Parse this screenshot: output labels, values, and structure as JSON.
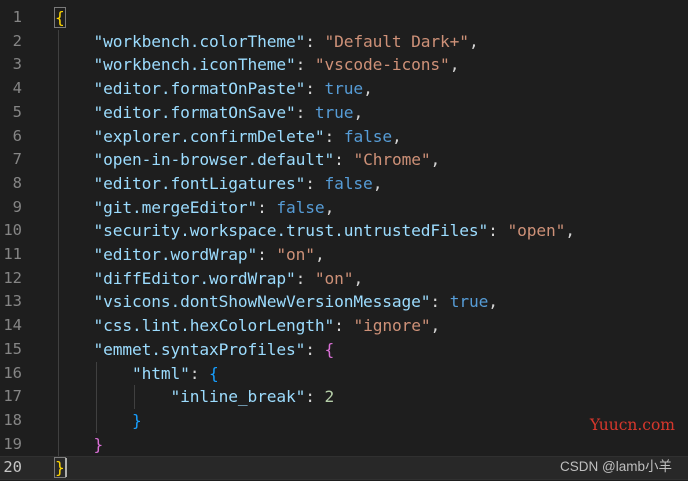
{
  "editor": {
    "lines": [
      {
        "number": "1",
        "tokens": [
          {
            "t": "{",
            "c": "tk-b1"
          }
        ]
      },
      {
        "number": "2",
        "tokens": [
          {
            "t": "    "
          },
          {
            "t": "\"workbench.colorTheme\"",
            "c": "tk-key"
          },
          {
            "t": ": ",
            "c": "tk-punc"
          },
          {
            "t": "\"Default Dark+\"",
            "c": "tk-str"
          },
          {
            "t": ",",
            "c": "tk-punc"
          }
        ]
      },
      {
        "number": "3",
        "tokens": [
          {
            "t": "    "
          },
          {
            "t": "\"workbench.iconTheme\"",
            "c": "tk-key"
          },
          {
            "t": ": ",
            "c": "tk-punc"
          },
          {
            "t": "\"vscode-icons\"",
            "c": "tk-str"
          },
          {
            "t": ",",
            "c": "tk-punc"
          }
        ]
      },
      {
        "number": "4",
        "tokens": [
          {
            "t": "    "
          },
          {
            "t": "\"editor.formatOnPaste\"",
            "c": "tk-key"
          },
          {
            "t": ": ",
            "c": "tk-punc"
          },
          {
            "t": "true",
            "c": "tk-bool"
          },
          {
            "t": ",",
            "c": "tk-punc"
          }
        ]
      },
      {
        "number": "5",
        "tokens": [
          {
            "t": "    "
          },
          {
            "t": "\"editor.formatOnSave\"",
            "c": "tk-key"
          },
          {
            "t": ": ",
            "c": "tk-punc"
          },
          {
            "t": "true",
            "c": "tk-bool"
          },
          {
            "t": ",",
            "c": "tk-punc"
          }
        ]
      },
      {
        "number": "6",
        "tokens": [
          {
            "t": "    "
          },
          {
            "t": "\"explorer.confirmDelete\"",
            "c": "tk-key"
          },
          {
            "t": ": ",
            "c": "tk-punc"
          },
          {
            "t": "false",
            "c": "tk-bool"
          },
          {
            "t": ",",
            "c": "tk-punc"
          }
        ]
      },
      {
        "number": "7",
        "tokens": [
          {
            "t": "    "
          },
          {
            "t": "\"open-in-browser.default\"",
            "c": "tk-key"
          },
          {
            "t": ": ",
            "c": "tk-punc"
          },
          {
            "t": "\"Chrome\"",
            "c": "tk-str"
          },
          {
            "t": ",",
            "c": "tk-punc"
          }
        ]
      },
      {
        "number": "8",
        "tokens": [
          {
            "t": "    "
          },
          {
            "t": "\"editor.fontLigatures\"",
            "c": "tk-key"
          },
          {
            "t": ": ",
            "c": "tk-punc"
          },
          {
            "t": "false",
            "c": "tk-bool"
          },
          {
            "t": ",",
            "c": "tk-punc"
          }
        ]
      },
      {
        "number": "9",
        "tokens": [
          {
            "t": "    "
          },
          {
            "t": "\"git.mergeEditor\"",
            "c": "tk-key"
          },
          {
            "t": ": ",
            "c": "tk-punc"
          },
          {
            "t": "false",
            "c": "tk-bool"
          },
          {
            "t": ",",
            "c": "tk-punc"
          }
        ]
      },
      {
        "number": "10",
        "tokens": [
          {
            "t": "    "
          },
          {
            "t": "\"security.workspace.trust.untrustedFiles\"",
            "c": "tk-key"
          },
          {
            "t": ": ",
            "c": "tk-punc"
          },
          {
            "t": "\"open\"",
            "c": "tk-str"
          },
          {
            "t": ",",
            "c": "tk-punc"
          }
        ]
      },
      {
        "number": "11",
        "tokens": [
          {
            "t": "    "
          },
          {
            "t": "\"editor.wordWrap\"",
            "c": "tk-key"
          },
          {
            "t": ": ",
            "c": "tk-punc"
          },
          {
            "t": "\"on\"",
            "c": "tk-str"
          },
          {
            "t": ",",
            "c": "tk-punc"
          }
        ]
      },
      {
        "number": "12",
        "tokens": [
          {
            "t": "    "
          },
          {
            "t": "\"diffEditor.wordWrap\"",
            "c": "tk-key"
          },
          {
            "t": ": ",
            "c": "tk-punc"
          },
          {
            "t": "\"on\"",
            "c": "tk-str"
          },
          {
            "t": ",",
            "c": "tk-punc"
          }
        ]
      },
      {
        "number": "13",
        "tokens": [
          {
            "t": "    "
          },
          {
            "t": "\"vsicons.dontShowNewVersionMessage\"",
            "c": "tk-key"
          },
          {
            "t": ": ",
            "c": "tk-punc"
          },
          {
            "t": "true",
            "c": "tk-bool"
          },
          {
            "t": ",",
            "c": "tk-punc"
          }
        ]
      },
      {
        "number": "14",
        "tokens": [
          {
            "t": "    "
          },
          {
            "t": "\"css.lint.hexColorLength\"",
            "c": "tk-key"
          },
          {
            "t": ": ",
            "c": "tk-punc"
          },
          {
            "t": "\"ignore\"",
            "c": "tk-str"
          },
          {
            "t": ",",
            "c": "tk-punc"
          }
        ]
      },
      {
        "number": "15",
        "tokens": [
          {
            "t": "    "
          },
          {
            "t": "\"emmet.syntaxProfiles\"",
            "c": "tk-key"
          },
          {
            "t": ": ",
            "c": "tk-punc"
          },
          {
            "t": "{",
            "c": "tk-b2"
          }
        ]
      },
      {
        "number": "16",
        "tokens": [
          {
            "t": "        "
          },
          {
            "t": "\"html\"",
            "c": "tk-key"
          },
          {
            "t": ": ",
            "c": "tk-punc"
          },
          {
            "t": "{",
            "c": "tk-b3"
          }
        ]
      },
      {
        "number": "17",
        "tokens": [
          {
            "t": "            "
          },
          {
            "t": "\"inline_break\"",
            "c": "tk-key"
          },
          {
            "t": ": ",
            "c": "tk-punc"
          },
          {
            "t": "2",
            "c": "tk-num"
          }
        ]
      },
      {
        "number": "18",
        "tokens": [
          {
            "t": "        "
          },
          {
            "t": "}",
            "c": "tk-b3"
          }
        ]
      },
      {
        "number": "19",
        "tokens": [
          {
            "t": "    "
          },
          {
            "t": "}",
            "c": "tk-b2"
          }
        ]
      },
      {
        "number": "20",
        "tokens": [
          {
            "t": "}",
            "c": "tk-b1"
          }
        ]
      }
    ],
    "current_line": "20"
  },
  "watermarks": {
    "site": "Yuucn.com",
    "author": "CSDN @lamb小羊"
  },
  "colors": {
    "background": "#1e1e1e",
    "property_key": "#9cdcfe",
    "string_value": "#ce9178",
    "keyword_value": "#569cd6",
    "number_value": "#b5cea8",
    "bracket_level_1": "#ffd700",
    "bracket_level_2": "#da70d6",
    "bracket_level_3": "#179fff",
    "line_number": "#858585",
    "watermark_red": "#d6372c"
  }
}
